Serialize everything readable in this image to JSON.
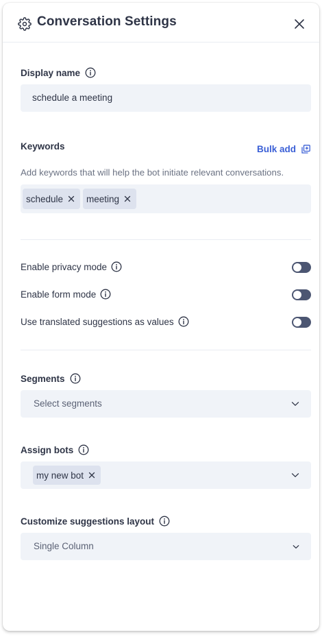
{
  "header": {
    "title": "Conversation Settings",
    "gear_icon": "gear-icon",
    "close_icon": "close-icon"
  },
  "display_name": {
    "label": "Display name",
    "value": "schedule a meeting"
  },
  "keywords": {
    "label": "Keywords",
    "bulk_add_label": "Bulk add",
    "helper": "Add keywords that will help the bot initiate relevant conversations.",
    "chips": [
      "schedule",
      "meeting"
    ]
  },
  "toggles": [
    {
      "label": "Enable privacy mode",
      "on": false
    },
    {
      "label": "Enable form mode",
      "on": false
    },
    {
      "label": "Use translated suggestions as values",
      "on": false
    }
  ],
  "segments": {
    "label": "Segments",
    "placeholder": "Select segments"
  },
  "assign_bots": {
    "label": "Assign bots",
    "chips": [
      "my new bot"
    ]
  },
  "suggestions_layout": {
    "label": "Customize suggestions layout",
    "value": "Single Column"
  },
  "colors": {
    "text": "#2e3446",
    "accent": "#3a5fd6",
    "field_bg": "#f0f3f8",
    "chip_bg": "#dde2ee",
    "toggle_off": "#4c5672"
  }
}
